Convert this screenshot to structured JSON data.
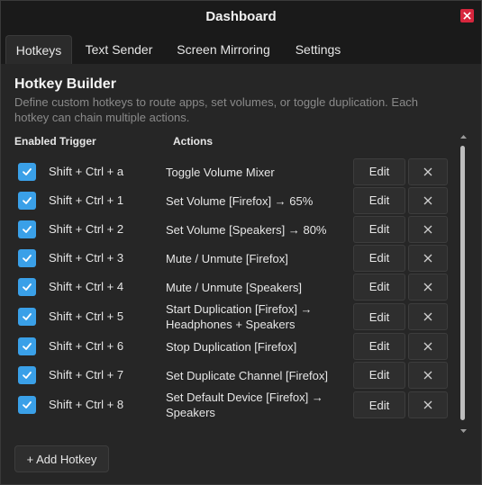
{
  "window": {
    "title": "Dashboard"
  },
  "tabs": [
    {
      "label": "Hotkeys",
      "active": true
    },
    {
      "label": "Text Sender",
      "active": false
    },
    {
      "label": "Screen Mirroring",
      "active": false
    },
    {
      "label": "Settings",
      "active": false
    }
  ],
  "header": {
    "title": "Hotkey Builder",
    "description": "Define custom hotkeys to route apps, set volumes, or toggle duplication. Each hotkey can chain multiple actions."
  },
  "columns": {
    "enabled_trigger": "Enabled Trigger",
    "actions": "Actions"
  },
  "rows": [
    {
      "enabled": true,
      "trigger": "Shift + Ctrl + a",
      "action": "Toggle Volume Mixer",
      "edit_label": "Edit"
    },
    {
      "enabled": true,
      "trigger": "Shift + Ctrl + 1",
      "action": "Set Volume [Firefox] → 65%",
      "edit_label": "Edit"
    },
    {
      "enabled": true,
      "trigger": "Shift + Ctrl + 2",
      "action": "Set Volume [Speakers] → 80%",
      "edit_label": "Edit"
    },
    {
      "enabled": true,
      "trigger": "Shift + Ctrl + 3",
      "action": "Mute / Unmute [Firefox]",
      "edit_label": "Edit"
    },
    {
      "enabled": true,
      "trigger": "Shift + Ctrl + 4",
      "action": "Mute / Unmute [Speakers]",
      "edit_label": "Edit"
    },
    {
      "enabled": true,
      "trigger": "Shift + Ctrl + 5",
      "action": "Start Duplication [Firefox] → Headphones + Speakers",
      "edit_label": "Edit"
    },
    {
      "enabled": true,
      "trigger": "Shift + Ctrl + 6",
      "action": "Stop Duplication [Firefox]",
      "edit_label": "Edit"
    },
    {
      "enabled": true,
      "trigger": "Shift + Ctrl + 7",
      "action": "Set Duplicate Channel [Firefox]",
      "edit_label": "Edit"
    },
    {
      "enabled": true,
      "trigger": "Shift + Ctrl + 8",
      "action": "Set Default Device [Firefox] → Speakers",
      "edit_label": "Edit"
    }
  ],
  "footer": {
    "add_label": "+ Add Hotkey"
  },
  "colors": {
    "accent": "#3aa0e8",
    "close": "#d7263d",
    "background": "#262626"
  }
}
